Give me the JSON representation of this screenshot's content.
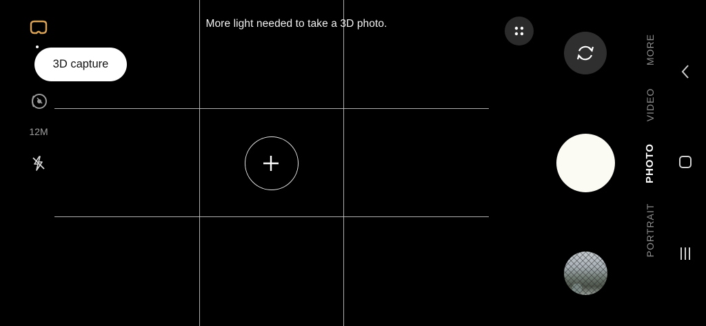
{
  "viewfinder": {
    "hint_text": "More light needed to take a 3D photo."
  },
  "left_toolbar": {
    "vr_mode_icon": "vr-headset-icon",
    "resolution_label": "12M",
    "flash_icon": "flash-off-icon",
    "motion_icon": "motion-photo-icon"
  },
  "tooltip": {
    "label": "3D capture"
  },
  "right_controls": {
    "grid_menu_icon": "four-dots-icon",
    "switch_camera_icon": "camera-switch-icon"
  },
  "modes": [
    {
      "label": "MORE"
    },
    {
      "label": "VIDEO"
    },
    {
      "label": "PHOTO"
    },
    {
      "label": "PORTRAIT"
    }
  ],
  "active_mode": "PHOTO",
  "system_nav": {
    "back_icon": "back-chevron-icon",
    "home_icon": "home-square-icon",
    "recents_icon": "recents-lines-icon"
  },
  "colors": {
    "background": "#000000",
    "accent_icon": "#d9a45a",
    "shutter": "#fbfbf4"
  }
}
